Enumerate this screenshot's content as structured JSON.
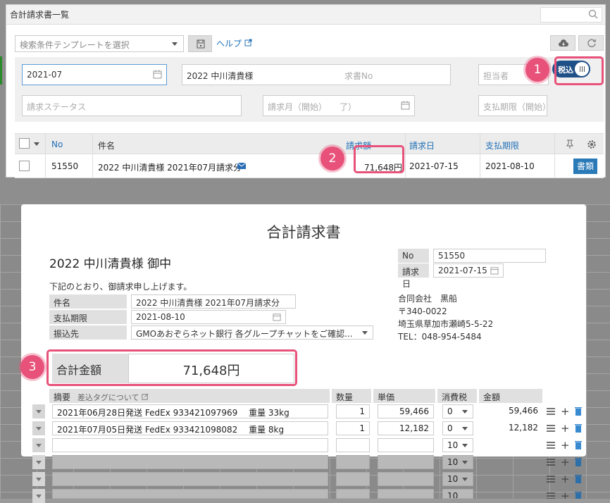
{
  "window": {
    "title": "合計請求書一覧"
  },
  "toolbar": {
    "template_placeholder": "検索条件テンプレートを選択",
    "help_label": "ヘルプ"
  },
  "filters": {
    "month": "2021-07",
    "customer": "2022 中川清貴様",
    "invoice_no_placeholder": "求書No",
    "assignee_placeholder": "担当者",
    "status_placeholder": "請求ステータス",
    "billing_month_placeholder": "請求月（開始）　　了）",
    "due_placeholder": "支払期限（開始）"
  },
  "tax_toggle": {
    "label": "税込"
  },
  "list": {
    "columns": {
      "no": "No",
      "subject": "件名",
      "amount": "請求額",
      "date": "請求日",
      "due": "支払期限"
    },
    "rows": [
      {
        "no": "51550",
        "subject": "2022 中川清貴様 2021年07月請求分",
        "amount": "71,648円",
        "date": "2021-07-15",
        "due": "2021-08-10",
        "doc_button": "書類"
      }
    ]
  },
  "callouts": [
    "1",
    "2",
    "3"
  ],
  "invoice": {
    "title": "合計請求書",
    "recipient": "2022 中川清貴様 御中",
    "note": "下記のとおり、御請求申し上げます。",
    "no_label": "No",
    "no_value": "51550",
    "date_label": "請求日",
    "date_value": "2021-07-15",
    "subject_label": "件名",
    "subject_value": "2022 中川清貴様 2021年07月請求分",
    "due_label": "支払期限",
    "due_value": "2021-08-10",
    "bank_label": "振込先",
    "bank_value": "GMOあおぞらネット銀行 各グループチャットをご確認...",
    "company": [
      "合同会社　黒船",
      "〒340-0022",
      "埼玉県草加市瀬崎5-5-22",
      "TEL：048-954-5484"
    ],
    "total_label": "合計金額",
    "total_value": "71,648円",
    "items_header": {
      "summary": "摘要",
      "tag_link": "差込タグについて",
      "qty": "数量",
      "price": "単価",
      "tax": "消費税",
      "amount": "金額"
    },
    "items": [
      {
        "summary": "2021年06月28日発送 FedEx 933421097969　 重量 33kg",
        "qty": "1",
        "price": "59,466",
        "tax": "0",
        "amount": "59,466"
      },
      {
        "summary": "2021年07月05日発送 FedEx 933421098082　 重量 8kg",
        "qty": "1",
        "price": "12,182",
        "tax": "0",
        "amount": "12,182"
      },
      {
        "summary": "",
        "qty": "",
        "price": "",
        "tax": "10",
        "amount": ""
      }
    ],
    "extra_rows_tax": [
      "10",
      "10",
      "10"
    ]
  }
}
